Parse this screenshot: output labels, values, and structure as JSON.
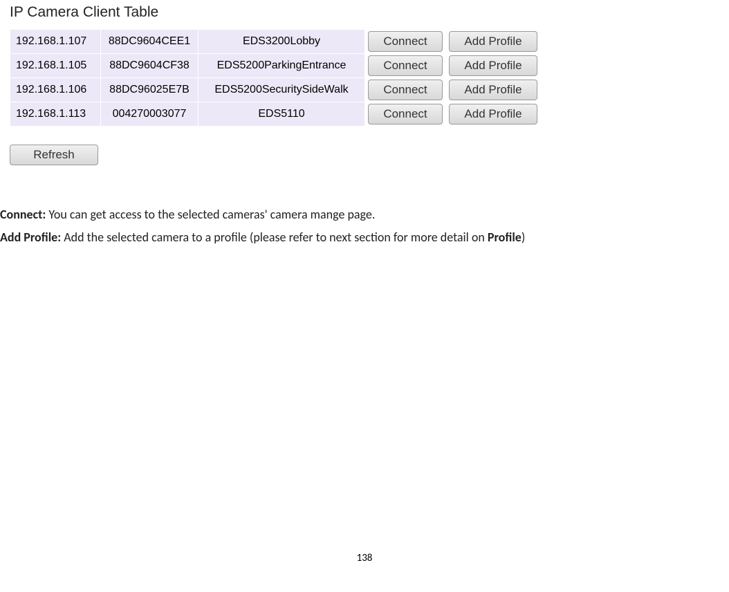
{
  "title": "IP Camera Client Table",
  "rows": [
    {
      "ip": "192.168.1.107",
      "mac": "88DC9604CEE1",
      "name": "EDS3200Lobby"
    },
    {
      "ip": "192.168.1.105",
      "mac": "88DC9604CF38",
      "name": "EDS5200ParkingEntrance"
    },
    {
      "ip": "192.168.1.106",
      "mac": "88DC96025E7B",
      "name": "EDS5200SecuritySideWalk"
    },
    {
      "ip": "192.168.1.113",
      "mac": "004270003077",
      "name": "EDS5110"
    }
  ],
  "buttons": {
    "connect": "Connect",
    "add_profile": "Add Profile",
    "refresh": "Refresh"
  },
  "description": {
    "connect_term": "Connect:",
    "connect_text": " You can get access to the selected cameras' camera mange page.",
    "addprofile_term": "Add Profile:",
    "addprofile_text1": " Add the selected camera to a profile (please refer to next section for more detail on ",
    "addprofile_bold": "Profile",
    "addprofile_text2": ")"
  },
  "page_number": "138"
}
